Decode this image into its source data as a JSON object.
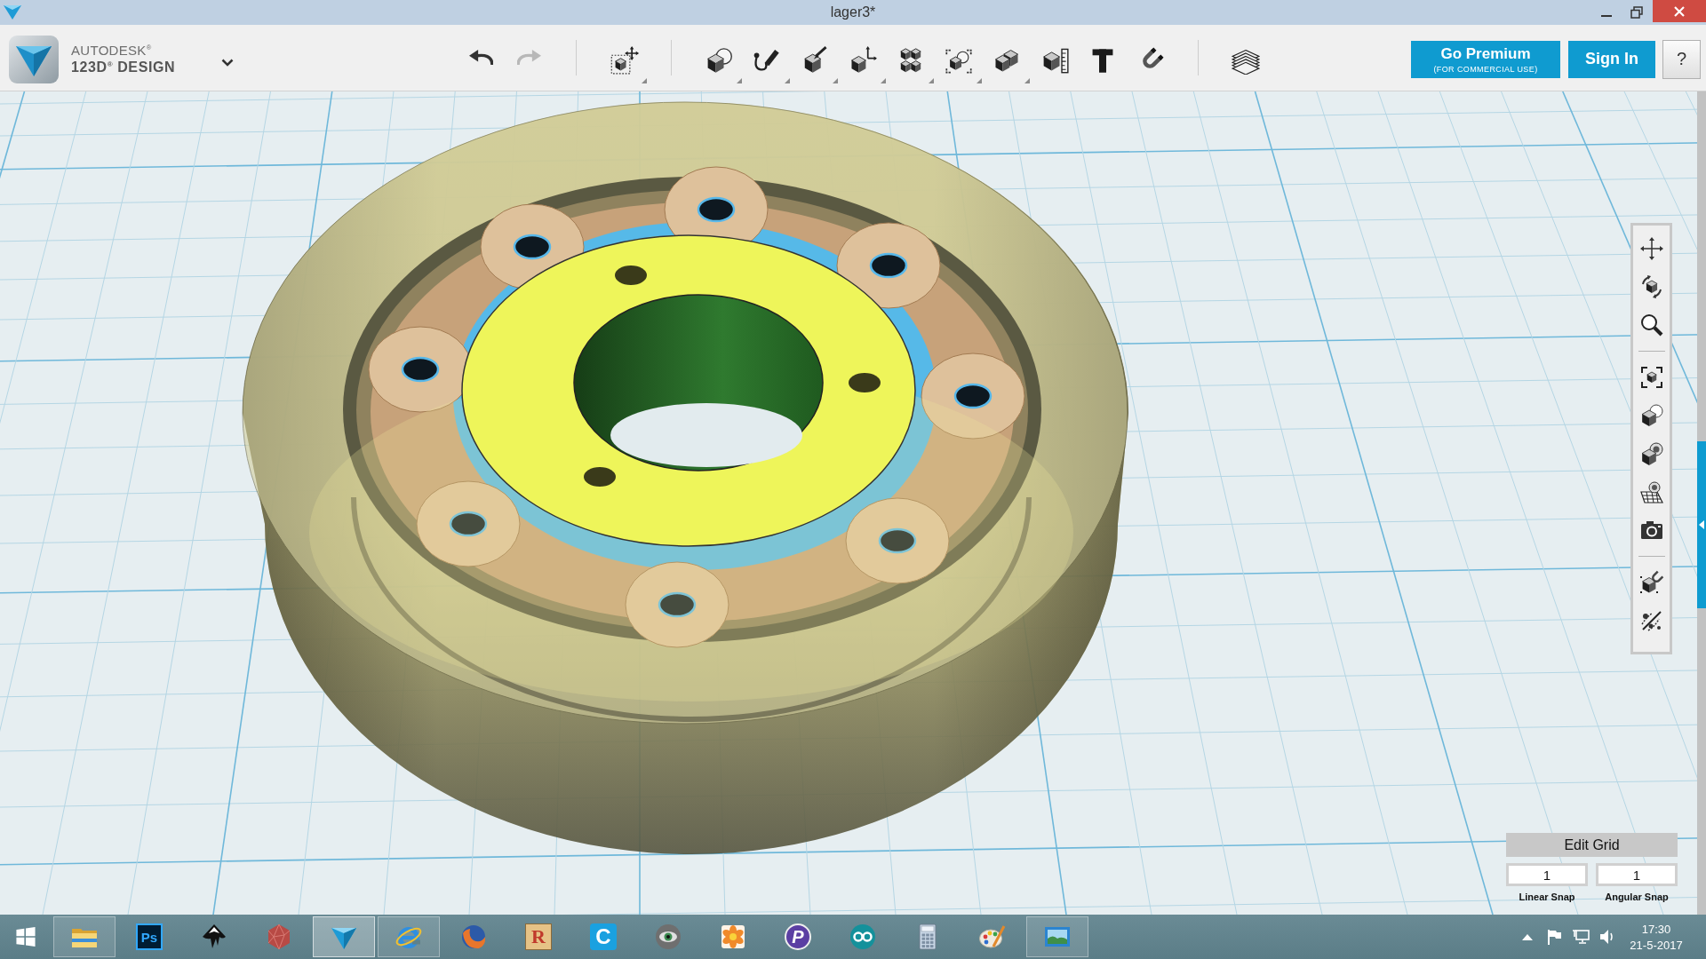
{
  "window": {
    "title": "lager3*"
  },
  "brand": {
    "line_1": "AUTODESK$^{®}$",
    "line_2": "123D$^{®}$ DESIGN"
  },
  "toolbar": {
    "undo": {
      "disabled": false
    },
    "redo": {
      "disabled": true
    }
  },
  "account": {
    "premium": {
      "label": "Go Premium",
      "note": "(FOR COMMERCIAL USE)"
    },
    "sign_in": "Sign In",
    "help": "?"
  },
  "edit_grid": {
    "title": "Edit Grid",
    "fields": [
      {
        "value": "1",
        "label": "Linear Snap"
      },
      {
        "value": "1",
        "label": "Angular Snap"
      }
    ]
  },
  "taskbar": {
    "apps": [
      {
        "kind": "folder",
        "running": true,
        "selected": false
      },
      {
        "kind": "tile",
        "glyph": "Ps",
        "running": false,
        "selected": false
      },
      {
        "kind": "ink",
        "running": false,
        "selected": false
      },
      {
        "kind": "gem",
        "running": false,
        "selected": false
      },
      {
        "kind": "triangle",
        "running": true,
        "selected": true
      },
      {
        "kind": "globe",
        "running": true,
        "selected": false
      },
      {
        "kind": "fox",
        "running": false,
        "selected": false
      },
      {
        "kind": "block",
        "glyph": "R",
        "running": false,
        "selected": false
      },
      {
        "kind": "badge",
        "glyph": "C",
        "running": false,
        "selected": false
      },
      {
        "kind": "eye",
        "running": false,
        "selected": false
      },
      {
        "kind": "flower",
        "running": false,
        "selected": false
      },
      {
        "kind": "disc",
        "glyph": "P",
        "running": false,
        "selected": false
      },
      {
        "kind": "infinity",
        "running": false,
        "selected": false
      },
      {
        "kind": "calculator",
        "running": false,
        "selected": false
      },
      {
        "kind": "palette",
        "running": false,
        "selected": false
      },
      {
        "kind": "picture",
        "running": true,
        "selected": false
      }
    ],
    "clock": {
      "time": "17:30",
      "date": "21-5-2017"
    }
  }
}
